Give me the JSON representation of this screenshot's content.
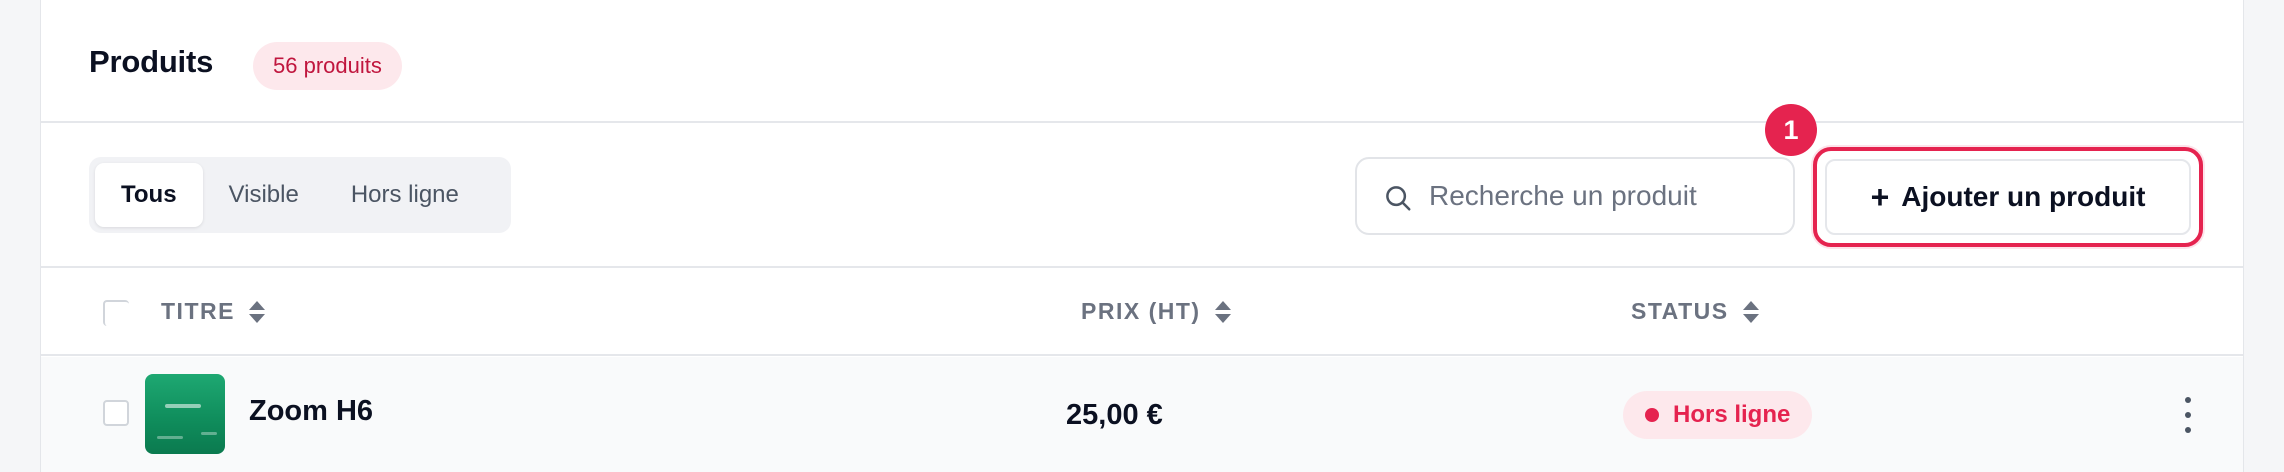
{
  "header": {
    "title": "Produits",
    "count_badge": "56 produits"
  },
  "filters": {
    "tabs": [
      {
        "label": "Tous",
        "active": true
      },
      {
        "label": "Visible",
        "active": false
      },
      {
        "label": "Hors ligne",
        "active": false
      }
    ]
  },
  "search": {
    "placeholder": "Recherche un produit",
    "value": "",
    "icon": "search-icon"
  },
  "add_button": {
    "plus": "+",
    "label": "Ajouter un produit",
    "step_badge": "1"
  },
  "table": {
    "columns": [
      {
        "label": "TITRE",
        "sortable": true
      },
      {
        "label": "PRIX (HT)",
        "sortable": true
      },
      {
        "label": "STATUS",
        "sortable": true
      }
    ],
    "rows": [
      {
        "title": "Zoom H6",
        "price": "25,00 €",
        "status": "Hors ligne",
        "selected": false
      }
    ]
  },
  "colors": {
    "accent": "#e5234f",
    "badge_bg": "#fde8ec",
    "text_dark": "#0b1021",
    "text_muted": "#6b7280"
  }
}
